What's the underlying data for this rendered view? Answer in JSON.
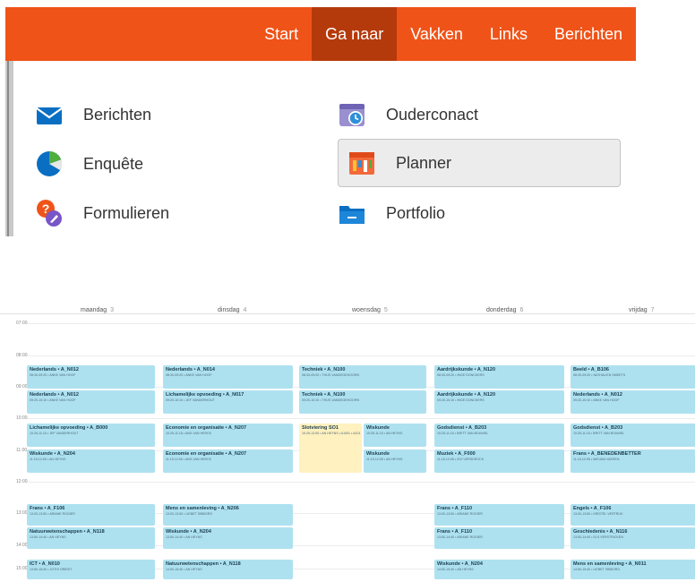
{
  "nav": {
    "items": [
      "Start",
      "Ga naar",
      "Vakken",
      "Links",
      "Berichten"
    ],
    "active": "Ga naar"
  },
  "menu": {
    "items": [
      {
        "label": "Berichten",
        "icon": "envelope-icon"
      },
      {
        "label": "Ouderconact",
        "icon": "calendar-clock-icon"
      },
      {
        "label": "Enquête",
        "icon": "pie-chart-icon"
      },
      {
        "label": "Planner",
        "icon": "planner-icon"
      },
      {
        "label": "Formulieren",
        "icon": "question-form-icon"
      },
      {
        "label": "Portfolio",
        "icon": "folder-icon"
      }
    ],
    "highlighted": "Planner"
  },
  "planner": {
    "days": [
      {
        "name": "maandag",
        "num": "3"
      },
      {
        "name": "dinsdag",
        "num": "4"
      },
      {
        "name": "woensdag",
        "num": "5"
      },
      {
        "name": "donderdag",
        "num": "6"
      },
      {
        "name": "vrijdag",
        "num": "7"
      }
    ],
    "times": [
      "07:00",
      "08:00",
      "09:00",
      "10:00",
      "11:00",
      "12:00",
      "13:00",
      "14:00",
      "15:00"
    ],
    "events": [
      {
        "title": "Nederlands • A_N012",
        "sub": "08:30-09:20 • ANKE VAN HOOF"
      },
      {
        "title": "Nederlands • A_N012",
        "sub": "09:20-10:10 • ANKE VAN HOOF"
      },
      {
        "title": "Lichamelijke opvoeding • A_B000",
        "sub": "10:25-11:15 • JEF VANDERHOUT"
      },
      {
        "title": "Wiskunde • A_N204",
        "sub": "11:15-12:05 • AN HEYNS"
      },
      {
        "title": "Frans • A_F106",
        "sub": "13:00-13:50 • ARIANE ROGIER"
      },
      {
        "title": "Natuurwetenschappen • A_N118",
        "sub": "13:50-14:40 • AN HEYNS"
      },
      {
        "title": "ICT • A_N010",
        "sub": "14:50-15:40 • JOTHI ORIEDT"
      },
      {
        "title": "Nederlands • A_N014",
        "sub": "08:30-09:20 • ANKE VAN HOOF"
      },
      {
        "title": "Lichamelijke opvoeding • A_N017",
        "sub": "09:20-10:10 • JEF VANDERHOUT"
      },
      {
        "title": "Economie en organisatie • A_N207",
        "sub": "10:25-11:15 • ANS VAN HERCK"
      },
      {
        "title": "Economie en organisatie • A_N207",
        "sub": "11:15-12:05 • ANS VAN HERCK"
      },
      {
        "title": "Mens en samenleving • A_N206",
        "sub": "13:00-13:50 • LIEBET SIBBORG"
      },
      {
        "title": "Wiskunde • A_N204",
        "sub": "13:50-14:40 • AN HEYNS"
      },
      {
        "title": "Natuurwetenschappen • A_N118",
        "sub": "14:50-15:40 • AN HEYNS"
      },
      {
        "title": "Techniek • A_N100",
        "sub": "08:30-09:20 • THIJS VANDEGEHOORN"
      },
      {
        "title": "Techniek • A_N100",
        "sub": "09:20-10:10 • THIJS VANDEGEHOORN"
      },
      {
        "title": "Slotviering SO1",
        "sub": "10:25-12:05 • AN HEYNS • A1001 • A101"
      },
      {
        "title": "Wiskunde",
        "sub": "10:25-11:15 • AN HEYNS"
      },
      {
        "title": "Wiskunde",
        "sub": "11:15-12:05 • AN HEYNS"
      },
      {
        "title": "Aardrijkskunde • A_N120",
        "sub": "08:30-09:20 • INGE DONCKERS"
      },
      {
        "title": "Aardrijkskunde • A_N120",
        "sub": "09:20-10:10 • INGE DONCKERS"
      },
      {
        "title": "Godsdienst • A_B203",
        "sub": "10:25-11:15 • BRITT VAN BOUWEL"
      },
      {
        "title": "Muziek • A_F000",
        "sub": "11:15-12:05 • ISO VERSDROCK"
      },
      {
        "title": "Frans • A_F110",
        "sub": "13:00-13:50 • ARIANE ROGIER"
      },
      {
        "title": "Frans • A_F110",
        "sub": "13:50-14:40 • ARIANE ROGIER"
      },
      {
        "title": "Wiskunde • A_N204",
        "sub": "14:50-15:40 • AN HEYNS"
      },
      {
        "title": "Beeld • A_B106",
        "sub": "08:30-09:20 • NATHALIEN SMEETS"
      },
      {
        "title": "Nederlands • A_N012",
        "sub": "09:20-10:10 • ANKE VAN HOOF"
      },
      {
        "title": "Godsdienst • A_B203",
        "sub": "10:25-11:15 • BRITT VAN BOUWEL"
      },
      {
        "title": "Frans • A_BENEDENBETTER",
        "sub": "11:15-12:05 • MIRJAM VAEREN"
      },
      {
        "title": "Engels • A_F106",
        "sub": "13:00-13:50 • KRISTEL VERTRIJK"
      },
      {
        "title": "Geschiedenis • A_N116",
        "sub": "13:50-14:40 • ELS VERSTRICKEN"
      },
      {
        "title": "Mens en samenleving • A_N011",
        "sub": "14:50-15:40 • LIEBET SIBBORG"
      }
    ]
  }
}
